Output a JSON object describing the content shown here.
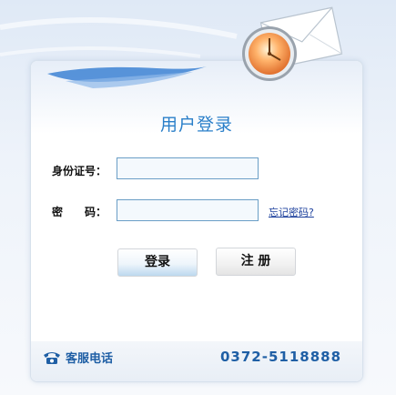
{
  "login": {
    "title": "用户登录",
    "id_label": "身份证号：",
    "id_value": "",
    "password_label": "密　　码：",
    "password_value": "",
    "forgot_link": "忘记密码?",
    "login_button": "登录",
    "register_button": "注 册"
  },
  "footer": {
    "service_label": "客服电话",
    "phone_number": "0372-5118888"
  },
  "icons": {
    "envelope": "envelope-icon",
    "clock": "clock-icon",
    "phone": "telephone-icon"
  },
  "colors": {
    "accent": "#2a7fc9",
    "footer_text": "#1f5fa5",
    "link": "#1b3f9c",
    "input_border": "#6a9ec6"
  }
}
